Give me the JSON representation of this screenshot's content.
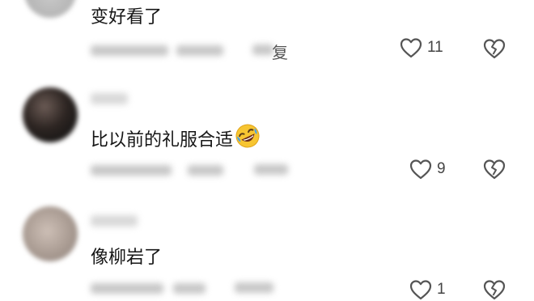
{
  "comments": [
    {
      "text": "变好看了",
      "reply_label": "复",
      "likes": "11",
      "icons": {
        "like": "heart-outline-icon",
        "dislike": "broken-heart-icon"
      }
    },
    {
      "text": "比以前的礼服合适",
      "emoji": "rolling-on-floor-laughing-emoji",
      "likes": "9",
      "icons": {
        "like": "heart-outline-icon",
        "dislike": "broken-heart-icon"
      }
    },
    {
      "text": "像柳岩了",
      "likes": "1",
      "icons": {
        "like": "heart-outline-icon",
        "dislike": "broken-heart-icon"
      }
    }
  ],
  "colors": {
    "text": "#161616",
    "icon": "#555555",
    "blur": "#c4c4c4"
  }
}
